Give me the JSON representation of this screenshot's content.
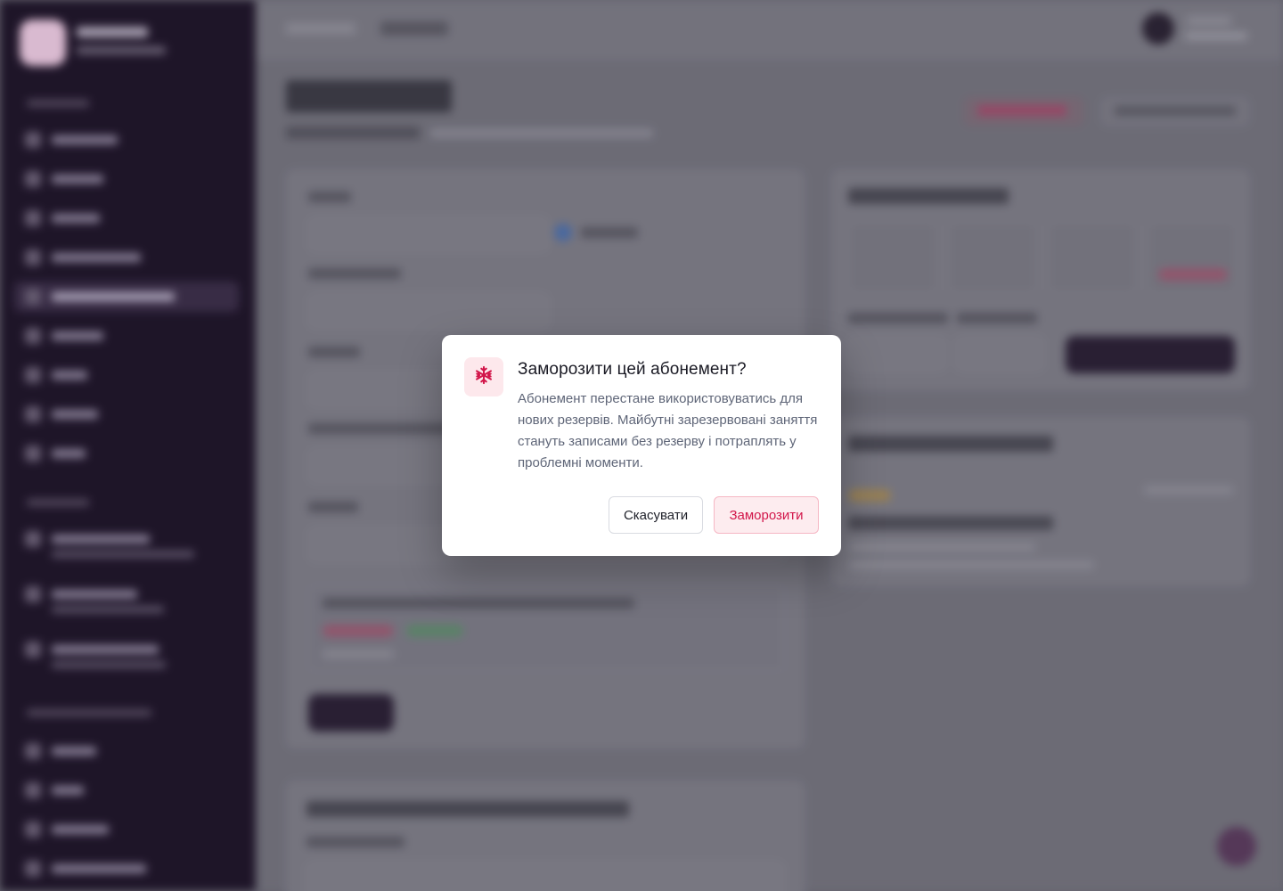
{
  "dialog": {
    "icon": "snowflake-icon",
    "title": "Заморозити цей абонемент?",
    "message": "Абонемент перестане використовуватись для нових резервів. Майбутні зарезервовані заняття стануть записами без резерву і потраплять у проблемні моменти.",
    "cancel_label": "Скасувати",
    "confirm_label": "Заморозити"
  },
  "colors": {
    "accent": "#d2164a",
    "icon_bg": "#fde8ec",
    "sidebar": "#1e1428",
    "overlay": "#6b6a75"
  }
}
